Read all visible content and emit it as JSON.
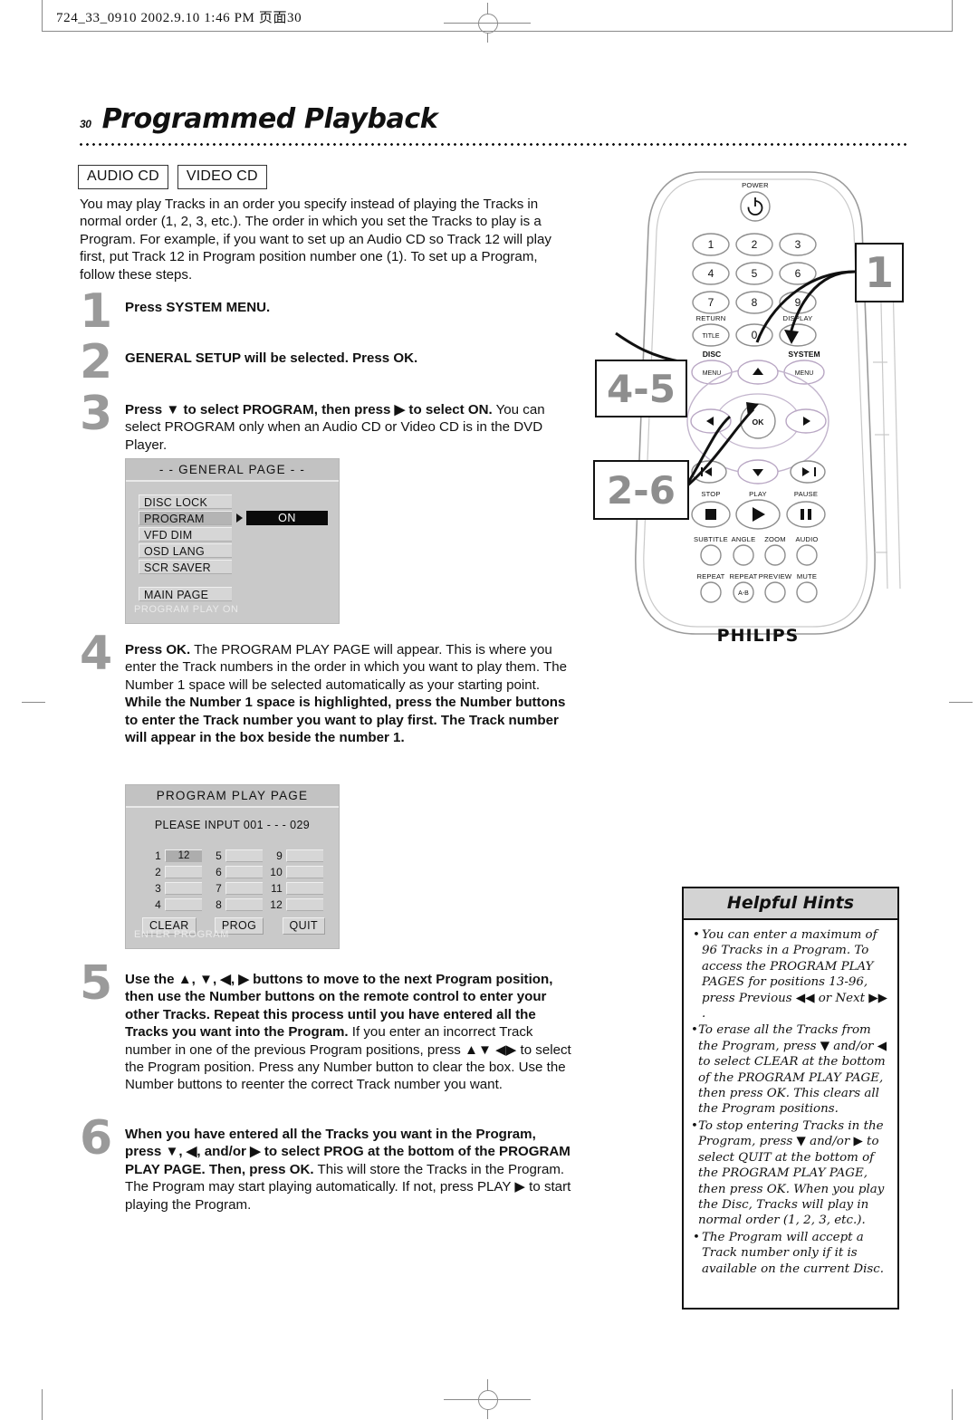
{
  "print_slug": "724_33_0910  2002.9.10 1:46 PM 页面30",
  "page": {
    "number": "30",
    "title": "Programmed Playback"
  },
  "badges": [
    {
      "label": "AUDIO CD"
    },
    {
      "label": "VIDEO CD"
    }
  ],
  "intro": "You may play Tracks in an order you specify instead of playing the Tracks in normal order (1, 2, 3, etc.). The order in which you set the Tracks to play is a Program. For example, if you want to set up an Audio CD so Track 12 will play first, put Track 12 in Program position number one (1). To set up a Program, follow these steps.",
  "steps": {
    "s1": {
      "num": "1",
      "bold": "Press SYSTEM MENU.",
      "rest": ""
    },
    "s2": {
      "num": "2",
      "bold": "GENERAL SETUP will be selected. Press OK.",
      "rest": ""
    },
    "s3": {
      "num": "3",
      "bold": "Press ▼ to select PROGRAM, then press ▶ to select ON.",
      "rest": "You can select PROGRAM only when an Audio CD or Video CD is in the DVD Player."
    },
    "s4": {
      "num": "4",
      "bold": "Press OK.",
      "rest": "The PROGRAM PLAY PAGE will appear. This is where you enter the Track numbers in the order in which you want to play them. The Number 1 space will be selected automatically as your starting point.",
      "bold2": "While the Number 1 space is highlighted, press the Number buttons to enter the Track number you want to play first. The Track number will appear in the box beside the number 1."
    },
    "s5": {
      "num": "5",
      "bold": "Use the ▲, ▼, ◀, ▶ buttons to move to the next Program position, then use the Number buttons on the remote control to enter your other Tracks. Repeat this process until you have entered all the Tracks you want into the Program.",
      "rest": "If you enter an incorrect Track number in one of the previous Program positions, press ▲▼ ◀▶ to select the Program position. Press any Number button to clear the box. Use the Number buttons to reenter the correct Track number you want."
    },
    "s6": {
      "num": "6",
      "bold": "When you have entered all the Tracks you want in the Program, press ▼, ◀, and/or ▶ to select PROG at the bottom of the PROGRAM PLAY PAGE. Then, press OK.",
      "rest": "This will store the Tracks in the Program. The Program may start playing automatically. If not, press PLAY ▶ to start playing the Program."
    }
  },
  "general_page": {
    "title": "- -  GENERAL PAGE  - -",
    "items": [
      {
        "label": "DISC LOCK",
        "selected": false
      },
      {
        "label": "PROGRAM",
        "selected": true
      },
      {
        "label": "VFD DIM",
        "selected": false
      },
      {
        "label": "OSD LANG",
        "selected": false
      },
      {
        "label": "SCR SAVER",
        "selected": false
      }
    ],
    "main_page_label": "MAIN PAGE",
    "value": "ON",
    "status": "PROGRAM PLAY ON"
  },
  "program_play_page": {
    "title": "PROGRAM PLAY PAGE",
    "prompt": "PLEASE INPUT 001 - - - 029",
    "slots": [
      {
        "label": "1",
        "value": "12",
        "selected": true
      },
      {
        "label": "5",
        "value": "",
        "selected": false
      },
      {
        "label": "9",
        "value": "",
        "selected": false
      },
      {
        "label": "2",
        "value": "",
        "selected": false
      },
      {
        "label": "6",
        "value": "",
        "selected": false
      },
      {
        "label": "10",
        "value": "",
        "selected": false
      },
      {
        "label": "3",
        "value": "",
        "selected": false
      },
      {
        "label": "7",
        "value": "",
        "selected": false
      },
      {
        "label": "11",
        "value": "",
        "selected": false
      },
      {
        "label": "4",
        "value": "",
        "selected": false
      },
      {
        "label": "8",
        "value": "",
        "selected": false
      },
      {
        "label": "12",
        "value": "",
        "selected": false
      }
    ],
    "buttons": [
      "CLEAR",
      "PROG",
      "QUIT"
    ],
    "status": "ENTER PROGRAM"
  },
  "remote": {
    "brand": "PHILIPS",
    "power_label": "POWER",
    "numbers": [
      "1",
      "2",
      "3",
      "4",
      "5",
      "6",
      "7",
      "8",
      "9"
    ],
    "zero": "0",
    "return_label": "RETURN",
    "title_label": "TITLE",
    "display_label": "DISPLAY",
    "disc_label": "DISC",
    "system_label": "SYSTEM",
    "menu_label": "MENU",
    "ok_label": "OK",
    "stop_label": "STOP",
    "play_label": "PLAY",
    "pause_label": "PAUSE",
    "feature_row_1": [
      "SUBTITLE",
      "ANGLE",
      "ZOOM",
      "AUDIO"
    ],
    "feature_row_2": [
      "REPEAT",
      "REPEAT",
      "PREVIEW",
      "MUTE"
    ],
    "ab_label": "A-B"
  },
  "callouts": [
    {
      "label": "1",
      "target": "system-menu"
    },
    {
      "label": "4-5",
      "target": "nav-cluster"
    },
    {
      "label": "2-6",
      "target": "ok-button"
    }
  ],
  "hints": {
    "title": "Helpful Hints",
    "items": [
      "You can enter a maximum of 96 Tracks in a Program. To access the PROGRAM PLAY PAGES for positions 13-96, press Previous ◀◀ or Next ▶▶ .",
      "To erase all the Tracks from the Program, press ▼ and/or ◀ to select CLEAR at the bottom of the PROGRAM PLAY PAGE, then press OK. This clears all the Program positions.",
      "To stop entering Tracks in the Program, press ▼ and/or ▶ to select QUIT at the bottom of the PROGRAM PLAY PAGE, then press OK. When you play the Disc, Tracks will play in normal order (1, 2, 3, etc.).",
      "The Program will accept a Track number only if it is available on the current Disc."
    ]
  }
}
